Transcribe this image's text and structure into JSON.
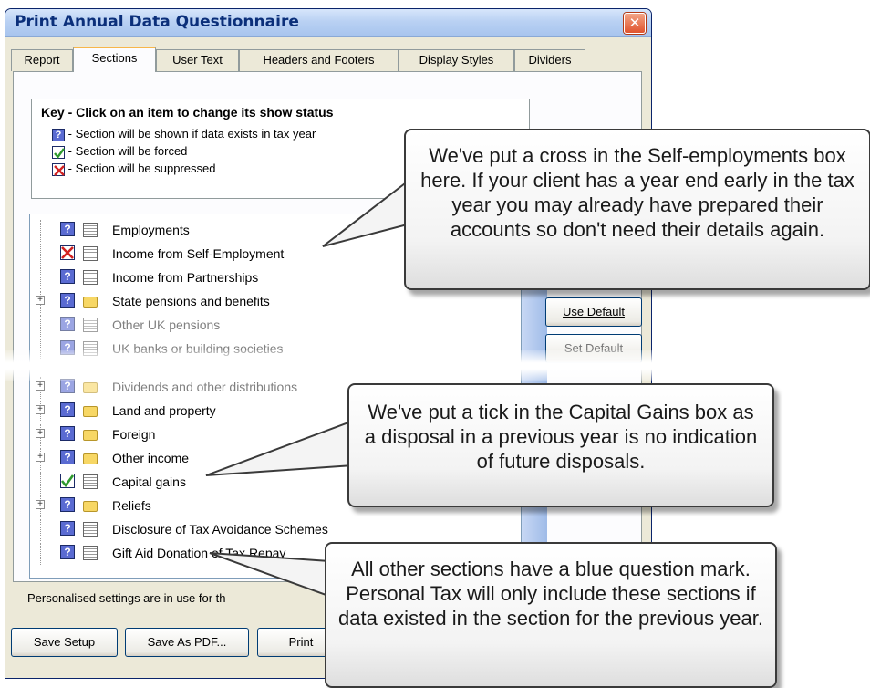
{
  "window": {
    "title": "Print Annual Data Questionnaire",
    "close_glyph": "✕"
  },
  "tabs": [
    "Report",
    "Sections",
    "User Text",
    "Headers and Footers",
    "Display Styles",
    "Dividers"
  ],
  "key": {
    "title": "Key - Click on an item to change its show status",
    "rows": [
      {
        "icon": "question-status-icon",
        "text": "- Section will be shown if data exists in tax year"
      },
      {
        "icon": "tick-status-icon",
        "text": "- Section will be forced"
      },
      {
        "icon": "cross-status-icon",
        "text": "- Section will be suppressed"
      }
    ]
  },
  "tree": [
    {
      "label": "Employments",
      "status": "question",
      "type": "calc",
      "expandable": false,
      "faded": false
    },
    {
      "label": "Income from Self-Employment",
      "status": "cross",
      "type": "calc",
      "expandable": false,
      "faded": false
    },
    {
      "label": "Income from Partnerships",
      "status": "question",
      "type": "calc",
      "expandable": false,
      "faded": false
    },
    {
      "label": "State pensions and benefits",
      "status": "question",
      "type": "folder",
      "expandable": true,
      "faded": false
    },
    {
      "label": "Other UK pensions",
      "status": "question",
      "type": "calc",
      "expandable": false,
      "faded": true
    },
    {
      "label": "UK banks or building societies",
      "status": "question",
      "type": "calc",
      "expandable": false,
      "faded": true
    },
    {
      "label": "Dividends and other distributions",
      "status": "question",
      "type": "folder",
      "expandable": true,
      "faded": true
    },
    {
      "label": "Land and property",
      "status": "question",
      "type": "folder",
      "expandable": true,
      "faded": false
    },
    {
      "label": "Foreign",
      "status": "question",
      "type": "folder",
      "expandable": true,
      "faded": false
    },
    {
      "label": "Other income",
      "status": "question",
      "type": "folder",
      "expandable": true,
      "faded": false
    },
    {
      "label": "Capital gains",
      "status": "tick",
      "type": "calc",
      "expandable": false,
      "faded": false
    },
    {
      "label": "Reliefs",
      "status": "question",
      "type": "folder",
      "expandable": true,
      "faded": false
    },
    {
      "label": "Disclosure of Tax Avoidance Schemes",
      "status": "question",
      "type": "calc",
      "expandable": false,
      "faded": false
    },
    {
      "label": "Gift Aid Donation of Tax Repay",
      "status": "question",
      "type": "calc",
      "expandable": false,
      "faded": false
    }
  ],
  "side_buttons": {
    "use_default": "Use Default",
    "set_default": "Set Default"
  },
  "status_text": "Personalised settings are in use for th",
  "footer_buttons": {
    "save_setup": "Save Setup",
    "save_pdf": "Save As PDF...",
    "print": "Print"
  },
  "callouts": {
    "self_employment": "We've put a cross in the Self-employments box here. If your client has a year end early in the tax year you may already have prepared their accounts so don't need their details again.",
    "capital_gains": "We've put a tick in the Capital Gains box as a disposal in a previous year is no indication of future disposals.",
    "other_sections": "All other sections have a blue question mark. Personal Tax will only include these sections if data existed in the section for the previous year."
  },
  "colors": {
    "question": "#5a6bd2",
    "tick": "#2e9a2e",
    "cross": "#d22222",
    "title_text": "#0b2f7a",
    "close": "#e0532e"
  }
}
